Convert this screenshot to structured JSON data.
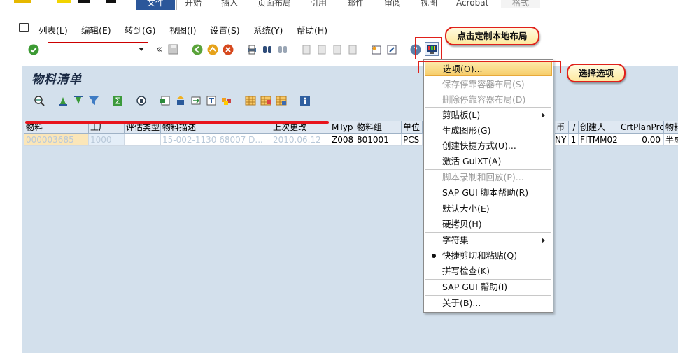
{
  "ribbon": {
    "tabs": [
      "文件",
      "开始",
      "插入",
      "页面布局",
      "引用",
      "邮件",
      "审阅",
      "视图",
      "Acrobat",
      "格式"
    ]
  },
  "menubar": {
    "items": [
      "列表(L)",
      "编辑(E)",
      "转到(G)",
      "视图(I)",
      "设置(S)",
      "系统(Y)",
      "帮助(H)"
    ]
  },
  "toolbar": {
    "command_field_value": "",
    "nav_arrow": "«"
  },
  "page": {
    "title": "物料清单"
  },
  "grid": {
    "columns": [
      "物料",
      "工厂",
      "评估类型",
      "物料描述",
      "上次更改",
      "MTyp",
      "物料组",
      "单位",
      "",
      "币",
      "/",
      "创建人",
      "CrtPlanPrc",
      "物料"
    ],
    "row": {
      "material": "000003685",
      "plant": "1000",
      "valuation_type": "",
      "description": "15-002-1130 68007 D...",
      "last_change": "2010.06.12",
      "mtyp": "Z008",
      "material_group": "801001",
      "unit": "PCS",
      "extra": "1",
      "currency": "NY",
      "slash": "1",
      "created_by": "FITMM02",
      "crt_plan_prc": "0.00",
      "material_type_desc": "半成"
    }
  },
  "context_menu": {
    "items": [
      {
        "label": "选项(O)...",
        "state": "selected"
      },
      {
        "label": "保存停靠容器布局(S)",
        "state": "disabled"
      },
      {
        "label": "删除停靠容器布局(D)",
        "state": "disabled"
      },
      {
        "label": "剪贴板(L)",
        "state": "submenu"
      },
      {
        "label": "生成图形(G)",
        "state": "normal"
      },
      {
        "label": "创建快捷方式(U)...",
        "state": "normal"
      },
      {
        "label": "激活 GuiXT(A)",
        "state": "normal"
      },
      {
        "label": "脚本录制和回放(P)...",
        "state": "disabled"
      },
      {
        "label": "SAP GUI 脚本帮助(R)",
        "state": "normal"
      },
      {
        "label": "默认大小(E)",
        "state": "normal"
      },
      {
        "label": "硬拷贝(H)",
        "state": "normal"
      },
      {
        "label": "字符集",
        "state": "submenu"
      },
      {
        "label": "快捷剪切和粘贴(Q)",
        "state": "checked"
      },
      {
        "label": "拼写检查(K)",
        "state": "normal"
      },
      {
        "label": "SAP GUI 帮助(I)",
        "state": "normal"
      },
      {
        "label": "关于(B)...",
        "state": "normal"
      }
    ]
  },
  "annotations": {
    "callout_customize": "点击定制本地布局",
    "callout_options": "选择选项"
  },
  "colors": {
    "sap_bg": "#d3e0ec",
    "highlight": "#f6cd6a",
    "annotation_red": "#e0201a"
  }
}
